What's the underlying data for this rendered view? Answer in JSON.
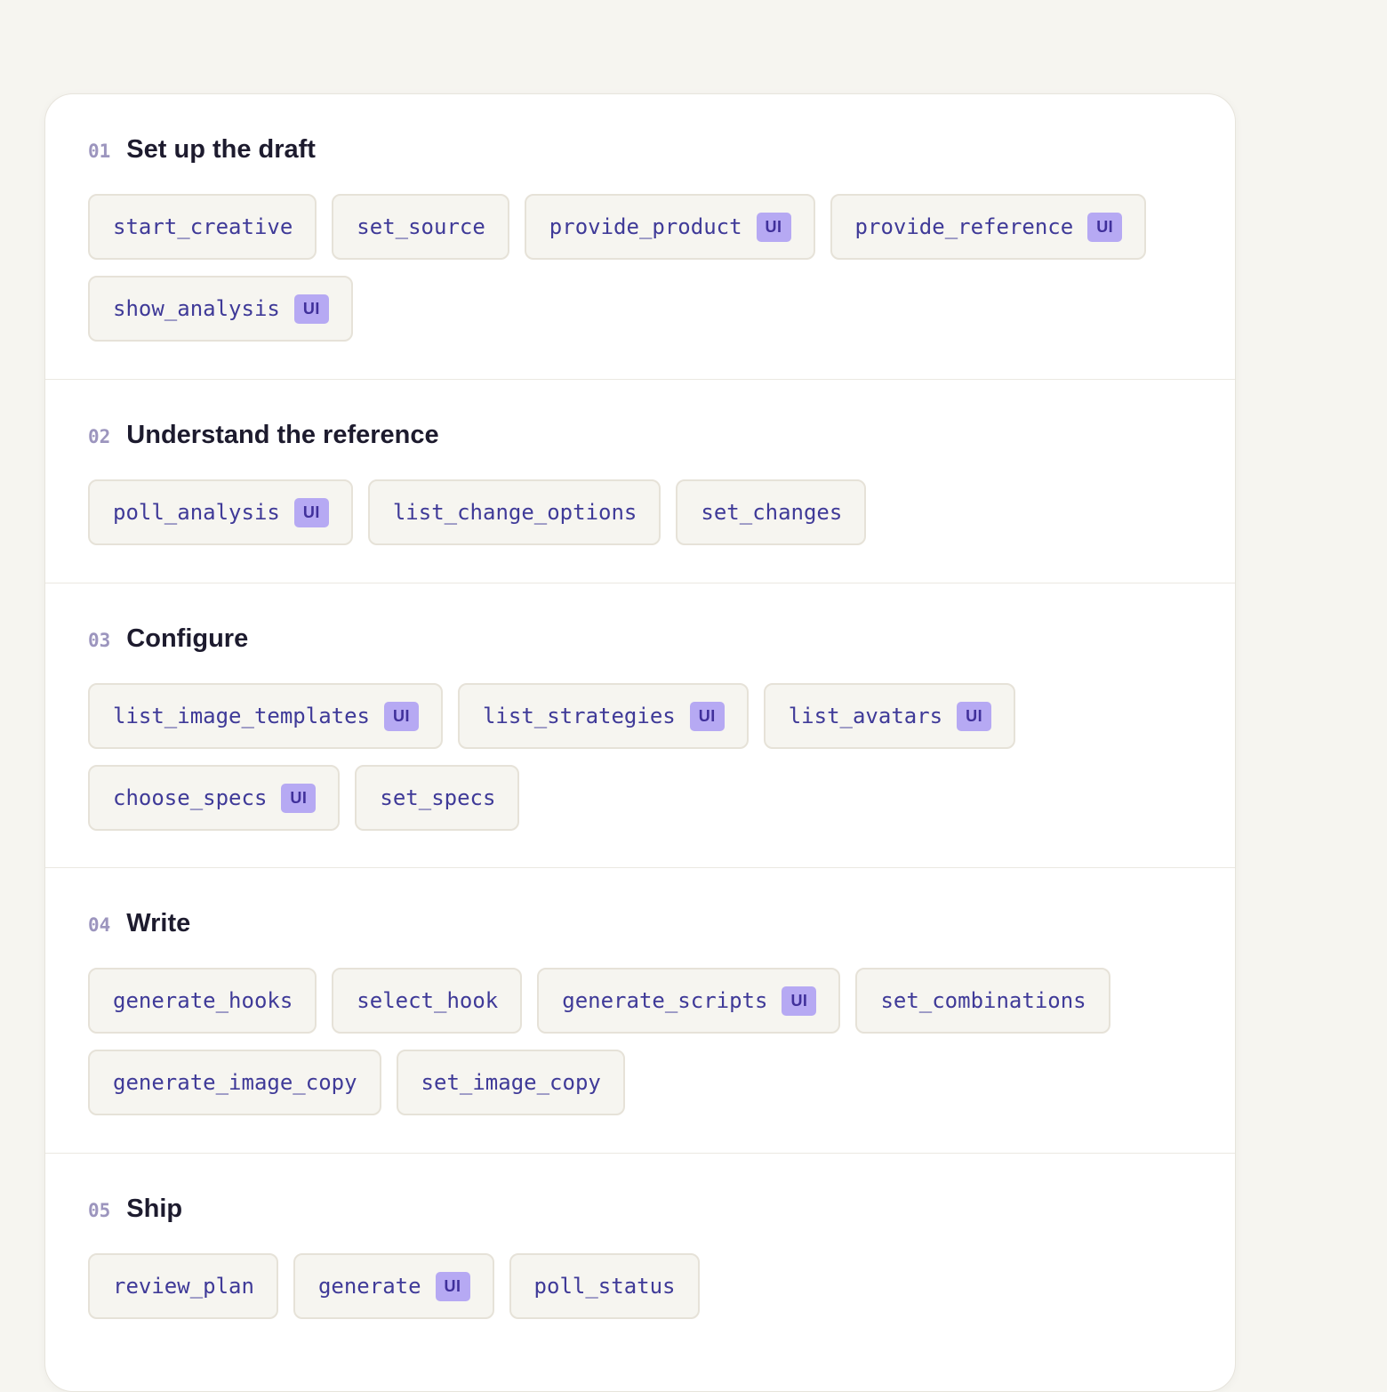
{
  "badge_label": "UI",
  "colors": {
    "background": "#f6f5f0",
    "card": "#ffffff",
    "chip_text": "#3f3a98",
    "badge_bg": "#b6a9f3",
    "section_number": "#9c95be",
    "heading": "#1d1b2e"
  },
  "sections": [
    {
      "number": "01",
      "title": "Set up the draft",
      "tools": [
        {
          "name": "start_creative",
          "ui": false
        },
        {
          "name": "set_source",
          "ui": false
        },
        {
          "name": "provide_product",
          "ui": true
        },
        {
          "name": "provide_reference",
          "ui": true
        },
        {
          "name": "show_analysis",
          "ui": true
        }
      ]
    },
    {
      "number": "02",
      "title": "Understand the reference",
      "tools": [
        {
          "name": "poll_analysis",
          "ui": true
        },
        {
          "name": "list_change_options",
          "ui": false
        },
        {
          "name": "set_changes",
          "ui": false
        }
      ]
    },
    {
      "number": "03",
      "title": "Configure",
      "tools": [
        {
          "name": "list_image_templates",
          "ui": true
        },
        {
          "name": "list_strategies",
          "ui": true
        },
        {
          "name": "list_avatars",
          "ui": true
        },
        {
          "name": "choose_specs",
          "ui": true
        },
        {
          "name": "set_specs",
          "ui": false
        }
      ]
    },
    {
      "number": "04",
      "title": "Write",
      "tools": [
        {
          "name": "generate_hooks",
          "ui": false
        },
        {
          "name": "select_hook",
          "ui": false
        },
        {
          "name": "generate_scripts",
          "ui": true
        },
        {
          "name": "set_combinations",
          "ui": false
        },
        {
          "name": "generate_image_copy",
          "ui": false
        },
        {
          "name": "set_image_copy",
          "ui": false
        }
      ]
    },
    {
      "number": "05",
      "title": "Ship",
      "tools": [
        {
          "name": "review_plan",
          "ui": false
        },
        {
          "name": "generate",
          "ui": true
        },
        {
          "name": "poll_status",
          "ui": false
        }
      ]
    }
  ]
}
